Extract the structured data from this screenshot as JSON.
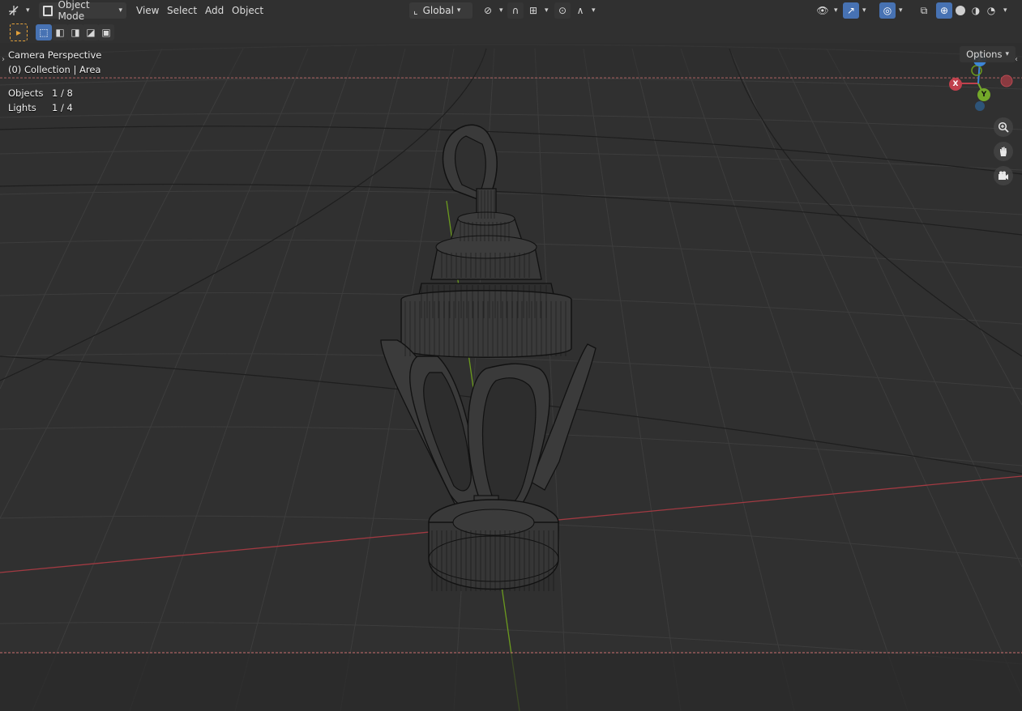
{
  "header": {
    "editor_icon": "transform-icon",
    "mode": "Object Mode",
    "menus": [
      "View",
      "Select",
      "Add",
      "Object"
    ],
    "transform_orientation": "Global",
    "options_label": "Options"
  },
  "viewport": {
    "view_name": "Camera Perspective",
    "collection": "(0) Collection | Area"
  },
  "stats": {
    "objects_label": "Objects",
    "objects_value": "1 / 8",
    "lights_label": "Lights",
    "lights_value": "1 / 4"
  },
  "gizmo": {
    "x": "X",
    "y": "Y",
    "z": "Z"
  },
  "colors": {
    "background": "#303030",
    "grid": "#3d3d3d",
    "x_axis": "#a23a42",
    "y_axis": "#6b9a1e",
    "accent": "#4772b3",
    "wire": "#111111"
  },
  "icons": [
    "cursor-select-icon",
    "zoom-icon",
    "pan-hand-icon",
    "camera-view-icon",
    "visibility-eye-icon",
    "gizmo-icon",
    "overlay-icon",
    "xray-icon",
    "wireframe-shading-icon",
    "solid-shading-icon",
    "material-shading-icon",
    "rendered-shading-icon"
  ]
}
